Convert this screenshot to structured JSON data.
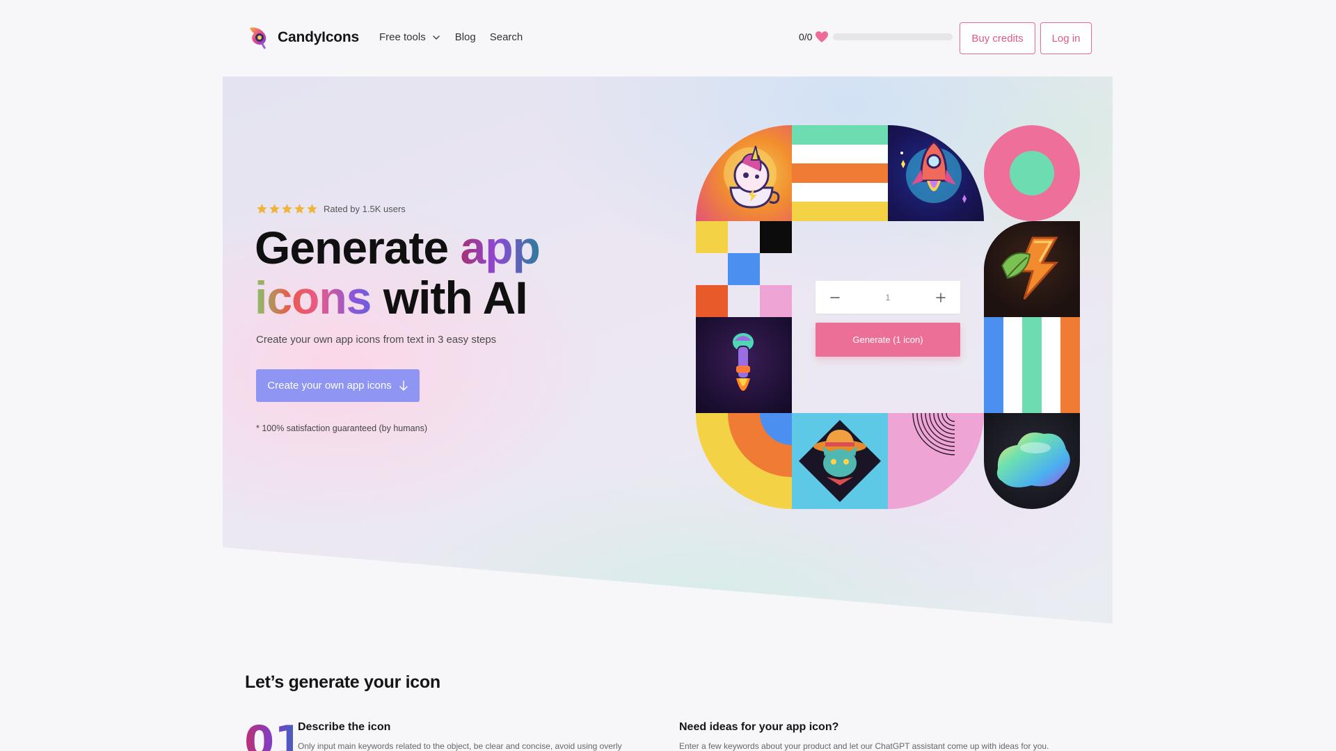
{
  "brand": {
    "name": "CandyIcons"
  },
  "nav": {
    "items": [
      {
        "label": "Free tools",
        "has_dropdown": true
      },
      {
        "label": "Blog"
      },
      {
        "label": "Search"
      }
    ]
  },
  "credits": {
    "text": "0/0",
    "fill_fraction": 0
  },
  "header_buttons": {
    "buy": "Buy credits",
    "login": "Log in"
  },
  "hero": {
    "stars": 5,
    "rating_text": "Rated by 1.5K users",
    "headline": {
      "part1": "Generate ",
      "part2": "app",
      "part3": "icons",
      "part4": " with AI"
    },
    "subtitle": "Create your own app icons from text in 3 easy steps",
    "cta": "Create your own app icons",
    "guarantee": "* 100% satisfaction guaranteed (by humans)"
  },
  "generator": {
    "quantity": "1",
    "button": "Generate (1 icon)"
  },
  "steps_section": {
    "title": "Let’s generate your icon",
    "step1": {
      "number": "01",
      "title": "Describe the icon",
      "description": "Only input main keywords related to the object, be clear and concise, avoid using overly"
    },
    "ideas": {
      "title": "Need ideas for your app icon?",
      "description": "Enter a few keywords about your product and let our ChatGPT assistant come up with ideas for you."
    }
  },
  "colors": {
    "accent_pink": "#ec6f98",
    "cta_purple": "#8f95f3",
    "background": "#f7f7fa"
  }
}
